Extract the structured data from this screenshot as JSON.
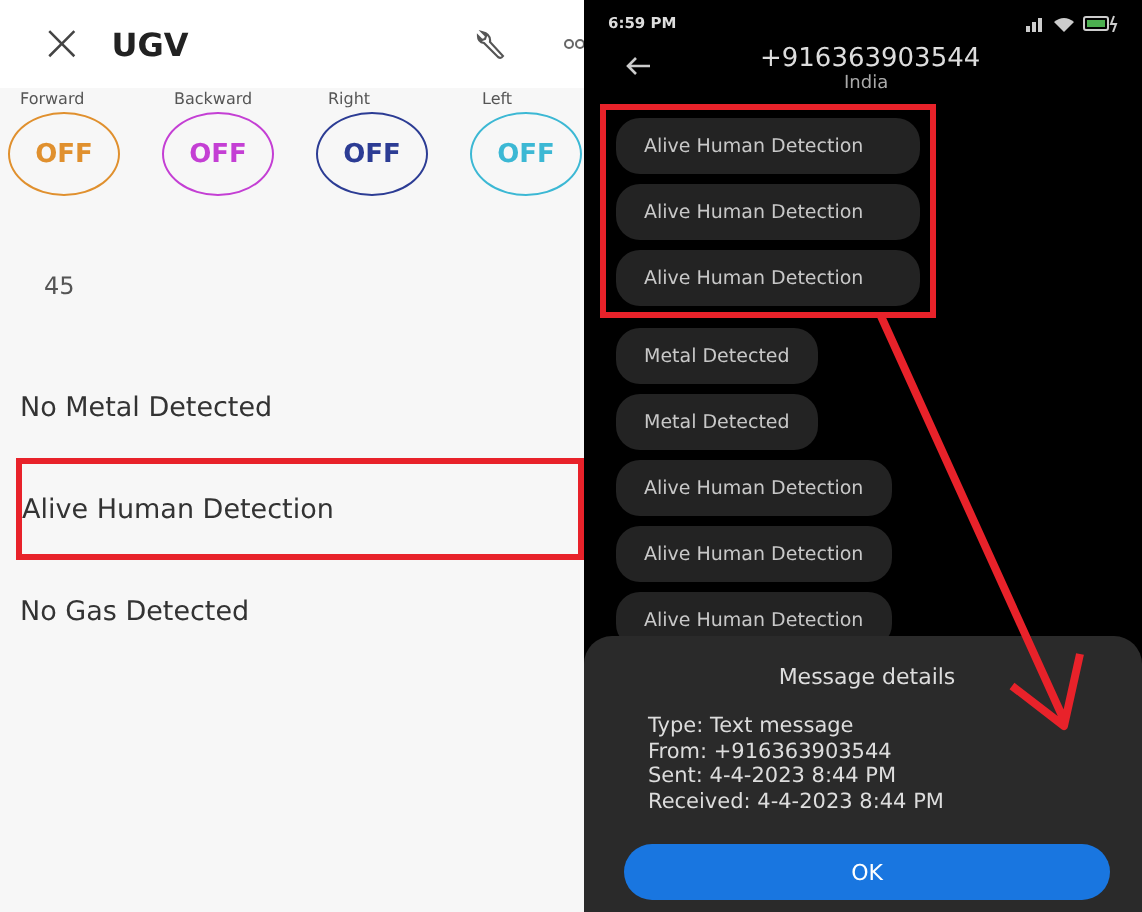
{
  "app_screen": {
    "header": {
      "close": "×",
      "title": "UGV"
    },
    "controls": [
      {
        "label": "Forward",
        "state": "OFF",
        "color": "#e0902e"
      },
      {
        "label": "Backward",
        "state": "OFF",
        "color": "#c43fd4"
      },
      {
        "label": "Right",
        "state": "OFF",
        "color": "#2c3c94"
      },
      {
        "label": "Left",
        "state": "OFF",
        "color": "#3cb8d4"
      }
    ],
    "reading": "45",
    "statuses": [
      {
        "text": "No Metal Detected",
        "highlighted": false
      },
      {
        "text": "Alive Human Detection",
        "highlighted": true
      },
      {
        "text": "No Gas Detected",
        "highlighted": false
      }
    ]
  },
  "messages_screen": {
    "status_bar": {
      "time": "6:59 PM"
    },
    "contact": {
      "number": "+916363903544",
      "country": "India"
    },
    "highlighted_messages": [
      "Alive Human Detection",
      "Alive Human Detection",
      "Alive Human Detection"
    ],
    "messages": [
      "Metal Detected",
      "Metal Detected",
      "Alive Human Detection",
      "Alive Human Detection",
      "Alive Human Detection"
    ],
    "dialog": {
      "title": "Message details",
      "lines": [
        "Type: Text message",
        "From: +916363903544",
        "Sent: 4-4-2023 8:44 PM",
        "Received: 4-4-2023 8:44 PM"
      ],
      "button": "OK"
    }
  }
}
